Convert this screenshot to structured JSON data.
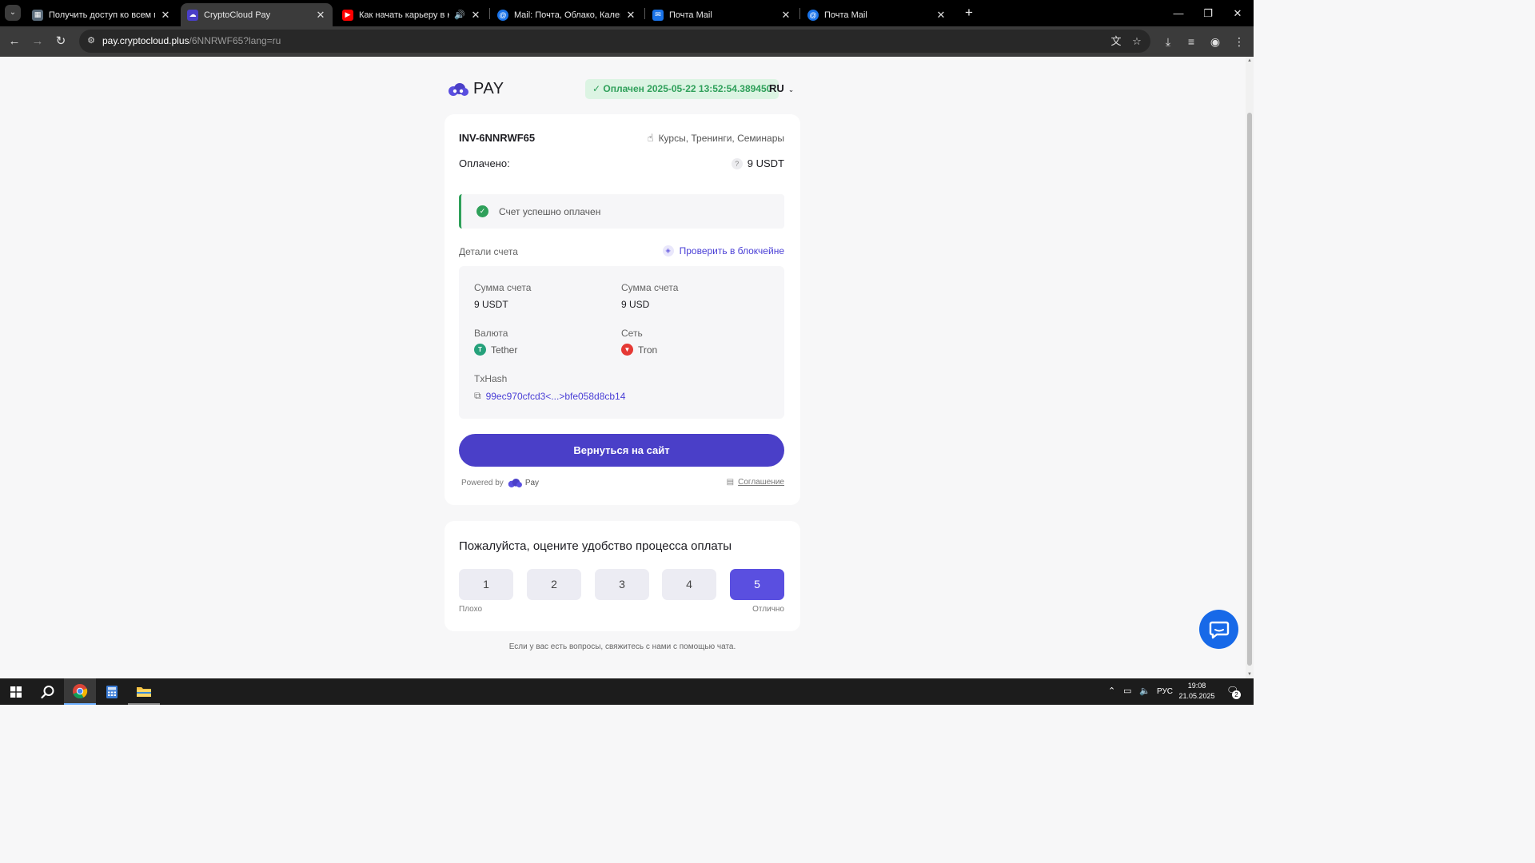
{
  "browser": {
    "tabs": [
      {
        "title": "Получить доступ ко всем мате",
        "favicon": "page-icon",
        "active": false
      },
      {
        "title": "CryptoCloud Pay",
        "favicon": "cryptocloud-icon",
        "active": true
      },
      {
        "title": "Как начать карьеру в кибе",
        "favicon": "youtube-icon",
        "active": false,
        "audio": true
      },
      {
        "title": "Mail: Почта, Облако, Календар",
        "favicon": "mail-at-icon",
        "active": false
      },
      {
        "title": "Почта Mail",
        "favicon": "mail-envelope-icon",
        "active": false
      },
      {
        "title": "Почта Mail",
        "favicon": "mail-at-icon",
        "active": false
      }
    ],
    "url_host": "pay.cryptocloud.plus",
    "url_path": "/6NNRWF65?lang=ru"
  },
  "header": {
    "logo_text": "PAY",
    "status_badge": "Оплачен 2025-05-22 13:52:54.389450",
    "language": "RU"
  },
  "invoice": {
    "id": "INV-6NNRWF65",
    "category": "Курсы, Тренинги, Семинары",
    "paid_label": "Оплачено:",
    "paid_amount": "9 USDT",
    "success_message": "Счет успешно оплачен",
    "details_label": "Детали счета",
    "verify_link": "Проверить в блокчейне",
    "details": {
      "sum_label_1": "Сумма счета",
      "sum_value_1": "9 USDT",
      "sum_label_2": "Сумма счета",
      "sum_value_2": "9 USD",
      "currency_label": "Валюта",
      "currency_value": "Tether",
      "network_label": "Сеть",
      "network_value": "Tron",
      "txhash_label": "TxHash",
      "txhash_value": "99ec970cfcd3<...>bfe058d8cb14"
    },
    "return_button": "Вернуться на сайт",
    "powered_by": "Powered by",
    "powered_brand": "Pay",
    "agreement": "Соглашение"
  },
  "rating": {
    "question": "Пожалуйста, оцените удобство процесса оплаты",
    "options": [
      "1",
      "2",
      "3",
      "4",
      "5"
    ],
    "selected": 5,
    "low_label": "Плохо",
    "high_label": "Отлично"
  },
  "footer_note": "Если у вас есть вопросы, свяжитесь с нами с помощью чата.",
  "taskbar": {
    "language": "РУС",
    "time": "19:08",
    "date": "21.05.2025",
    "notifications": "2"
  },
  "colors": {
    "accent": "#4a3fc8",
    "success": "#2fa05a",
    "selected_rating": "#5a4fe0",
    "chat": "#1769e8"
  }
}
